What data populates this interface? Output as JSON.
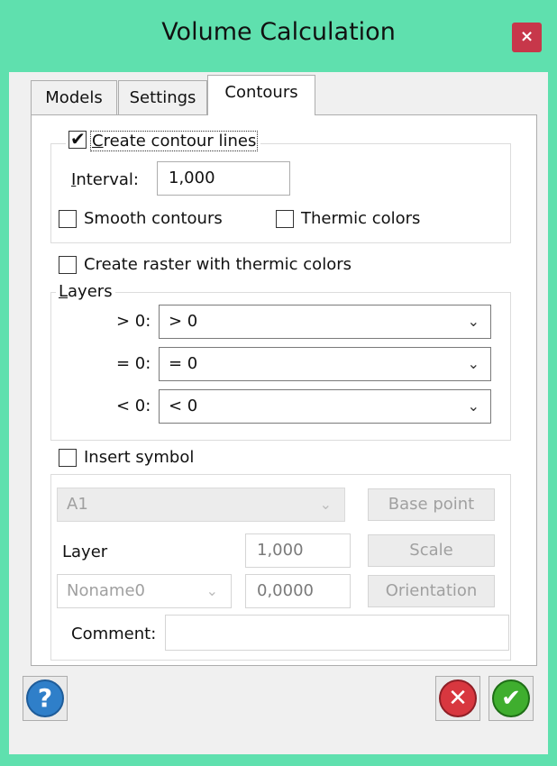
{
  "window": {
    "title": "Volume Calculation",
    "close_glyph": "×"
  },
  "tabs": [
    {
      "label": "Models"
    },
    {
      "label": "Settings"
    },
    {
      "label": "Contours",
      "active": true
    }
  ],
  "contours": {
    "create_lines": {
      "label_prefix": "C",
      "label_rest": "reate contour lines",
      "checked": true
    },
    "interval": {
      "label_prefix": "I",
      "label_rest": "nterval:",
      "value": "1,000"
    },
    "smooth": {
      "label": "Smooth contours",
      "checked": false
    },
    "thermic": {
      "label": "Thermic colors",
      "checked": false
    }
  },
  "raster": {
    "label": "Create raster with thermic colors",
    "checked": false
  },
  "layers": {
    "legend_prefix": "L",
    "legend_rest": "ayers",
    "rows": [
      {
        "label": "> 0:",
        "value": "> 0"
      },
      {
        "label": "= 0:",
        "value": "= 0"
      },
      {
        "label": "< 0:",
        "value": "< 0"
      }
    ]
  },
  "symbol": {
    "insert_label": "Insert symbol",
    "checked": false,
    "symbol_select": "A1",
    "base_point_label": "Base point",
    "layer_label": "Layer",
    "layer_select": "Noname0",
    "scale_value": "1,000",
    "scale_label": "Scale",
    "orientation_value": "0,0000",
    "orientation_label": "Orientation",
    "comment_label": "Comment:",
    "comment_value": ""
  },
  "footer": {
    "help_icon": "question-mark-icon",
    "cancel_icon": "red-x-icon",
    "ok_icon": "green-check-icon"
  },
  "colors": {
    "title_bar": "#5fe0ae",
    "close_button": "#c7374a",
    "help": "#2f7fc9",
    "cancel": "#d8373f",
    "ok": "#3fae2e"
  }
}
